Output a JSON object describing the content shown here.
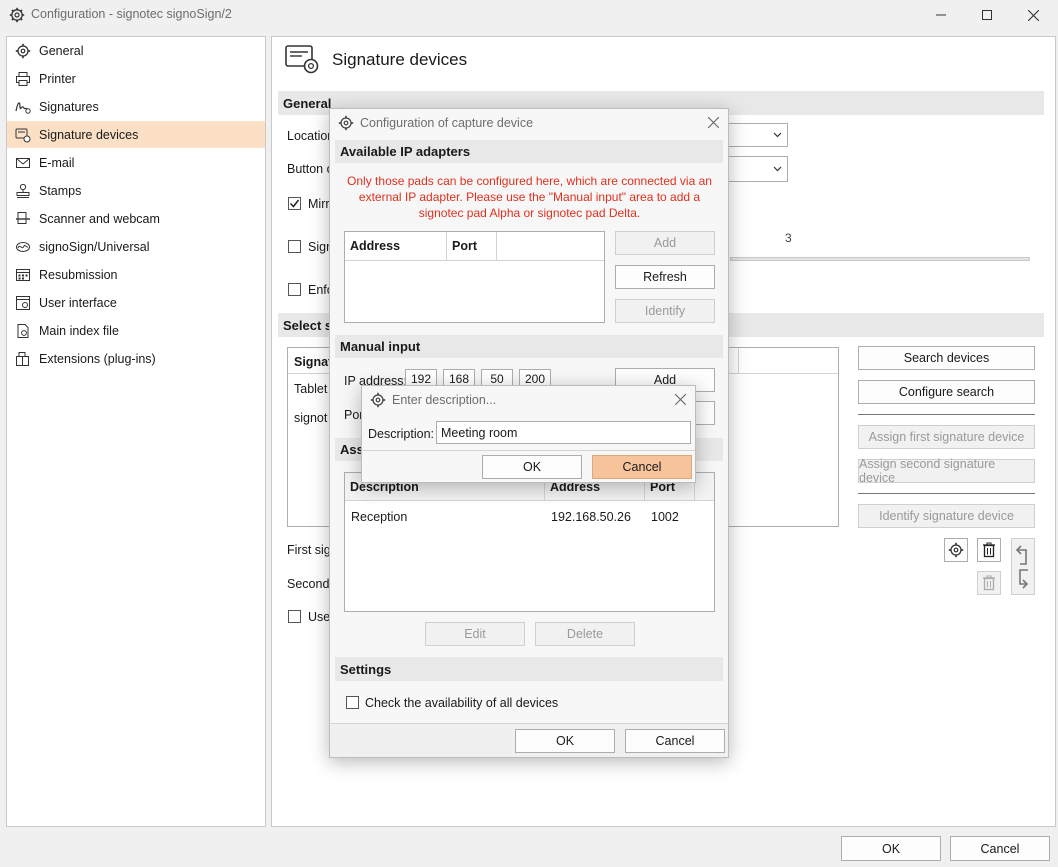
{
  "window": {
    "title": "Configuration - signotec signoSign/2"
  },
  "sidebar": {
    "selected_index": 3,
    "items": [
      {
        "label": "General",
        "icon": "gear-icon"
      },
      {
        "label": "Printer",
        "icon": "printer-icon"
      },
      {
        "label": "Signatures",
        "icon": "signature-icon"
      },
      {
        "label": "Signature devices",
        "icon": "signature-device-icon"
      },
      {
        "label": "E-mail",
        "icon": "email-icon"
      },
      {
        "label": "Stamps",
        "icon": "stamp-icon"
      },
      {
        "label": "Scanner and webcam",
        "icon": "scanner-icon"
      },
      {
        "label": "signoSign/Universal",
        "icon": "universal-icon"
      },
      {
        "label": "Resubmission",
        "icon": "resubmission-icon"
      },
      {
        "label": "User interface",
        "icon": "user-interface-icon"
      },
      {
        "label": "Main index file",
        "icon": "index-file-icon"
      },
      {
        "label": "Extensions (plug-ins)",
        "icon": "plugin-icon"
      }
    ]
  },
  "main": {
    "title": "Signature devices",
    "general_header": "General",
    "location_label": "Location",
    "button_label": "Button c",
    "mirror_label": "Mirr",
    "sign_label": "Sign",
    "enforce_label": "Enfo",
    "slider_value": "3",
    "select_header": "Select s",
    "table_header": "Signat",
    "table_rows": [
      "Tablet",
      "signot"
    ],
    "first_label": "First sig",
    "second_label": "Second",
    "use_label": "Use",
    "buttons": {
      "search": "Search devices",
      "configure": "Configure search",
      "assign_first": "Assign first signature device",
      "assign_second": "Assign second signature device",
      "identify": "Identify signature device"
    },
    "mirror_checked": true
  },
  "capture_dialog": {
    "title": "Configuration of capture device",
    "adapters_header": "Available IP adapters",
    "warning": "Only those pads can be configured here, which are connected via an external IP adapter. Please use the \"Manual input\" area to add a signotec pad Alpha or signotec pad Delta.",
    "adapter_columns": [
      "Address",
      "Port"
    ],
    "add_button": "Add",
    "refresh_button": "Refresh",
    "identify_button": "Identify",
    "manual_header": "Manual input",
    "ip_label": "IP address:",
    "ip_parts": [
      "192",
      "168",
      "50",
      "200"
    ],
    "port_label": "Por",
    "manual_add_button": "Add",
    "assigned_header": "Assi",
    "assigned_columns": [
      "Description",
      "Address",
      "Port"
    ],
    "assigned_rows": [
      {
        "description": "Reception",
        "address": "192.168.50.26",
        "port": "1002"
      }
    ],
    "edit_button": "Edit",
    "delete_button": "Delete",
    "settings_header": "Settings",
    "check_label": "Check the availability of all devices",
    "ok_button": "OK",
    "cancel_button": "Cancel",
    "warning_color": "#e0301e"
  },
  "desc_dialog": {
    "title": "Enter description...",
    "label": "Description:",
    "value": "Meeting room",
    "ok_button": "OK",
    "cancel_button": "Cancel"
  },
  "footer": {
    "ok_button": "OK",
    "cancel_button": "Cancel"
  }
}
